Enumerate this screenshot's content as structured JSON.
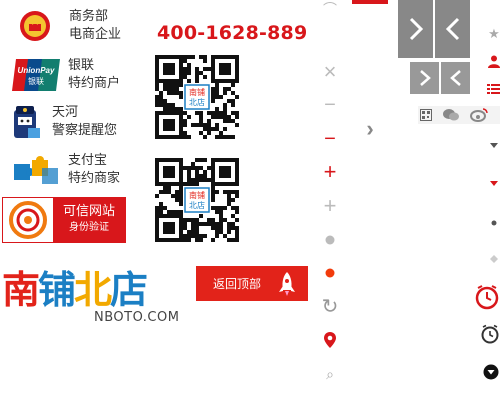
{
  "badges": {
    "mofcom": {
      "line1": "商务部",
      "line2": "电商企业"
    },
    "unionpay": {
      "line1": "银联",
      "line2": "特约商户",
      "logo_text": "UnionPay",
      "logo_sub": "银联"
    },
    "tianhe": {
      "line1": "天河",
      "line2": "警察提醒您"
    },
    "alipay": {
      "line1": "支付宝",
      "line2": "特约商家"
    }
  },
  "hotline": "400-1628-889",
  "trust_badge": {
    "title": "可信网站",
    "subtitle": "身份验证"
  },
  "brand": {
    "name_chars": [
      "南",
      "铺",
      "北",
      "店"
    ],
    "url": "NBOTO.COM"
  },
  "back_to_top": {
    "label": "返回顶部"
  },
  "qr_center_chars": [
    "南铺",
    "北店"
  ],
  "side_symbols": {
    "close": "×",
    "minus": "−",
    "plus": "+",
    "refresh": "↻",
    "search": "⌕",
    "chevron_right": "›"
  },
  "colors": {
    "accent_red": "#d8171b",
    "arrow_gray": "#888888",
    "brand_red": "#e2231a",
    "brand_blue": "#1b7fc4",
    "brand_yellow": "#f2a900"
  }
}
